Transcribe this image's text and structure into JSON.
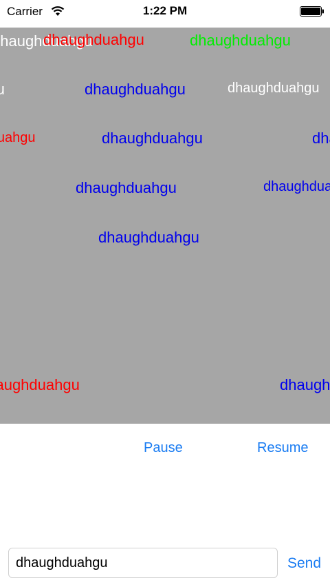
{
  "status_bar": {
    "carrier": "Carrier",
    "time": "1:22 PM"
  },
  "danmaku": [
    {
      "text": "dhaughduahgu",
      "color": "#ffffff"
    },
    {
      "text": "dhaughduahgu",
      "color": "#ff0000"
    },
    {
      "text": "dhaughduahgu",
      "color": "#00ee00"
    },
    {
      "text": "dhaughduahgu",
      "color": "#ffffff"
    },
    {
      "text": "dhaughduahgu",
      "color": "#0000ee"
    },
    {
      "text": "dhaughduahgu",
      "color": "#ffffff"
    },
    {
      "text": "dhaughduahgu",
      "color": "#ff0000"
    },
    {
      "text": "dhaughduahgu",
      "color": "#0000ee"
    },
    {
      "text": "dhaughduahgu",
      "color": "#0000ee"
    },
    {
      "text": "dhaughduahgu",
      "color": "#0000ee"
    },
    {
      "text": "dhaughduahgu",
      "color": "#0000ee"
    },
    {
      "text": "dhaughduahgu",
      "color": "#0000ee"
    },
    {
      "text": "dhaughduahgu",
      "color": "#ff0000"
    },
    {
      "text": "dhaughduahgu",
      "color": "#0000ee"
    }
  ],
  "controls": {
    "pause_label": "Pause",
    "resume_label": "Resume"
  },
  "input_bar": {
    "value": "dhaughduahgu",
    "send_label": "Send"
  },
  "colors": {
    "accent": "#1a7cf2",
    "stage_background": "#a6a6a6"
  },
  "icons": {
    "wifi": "wifi-icon",
    "battery": "battery-icon"
  }
}
